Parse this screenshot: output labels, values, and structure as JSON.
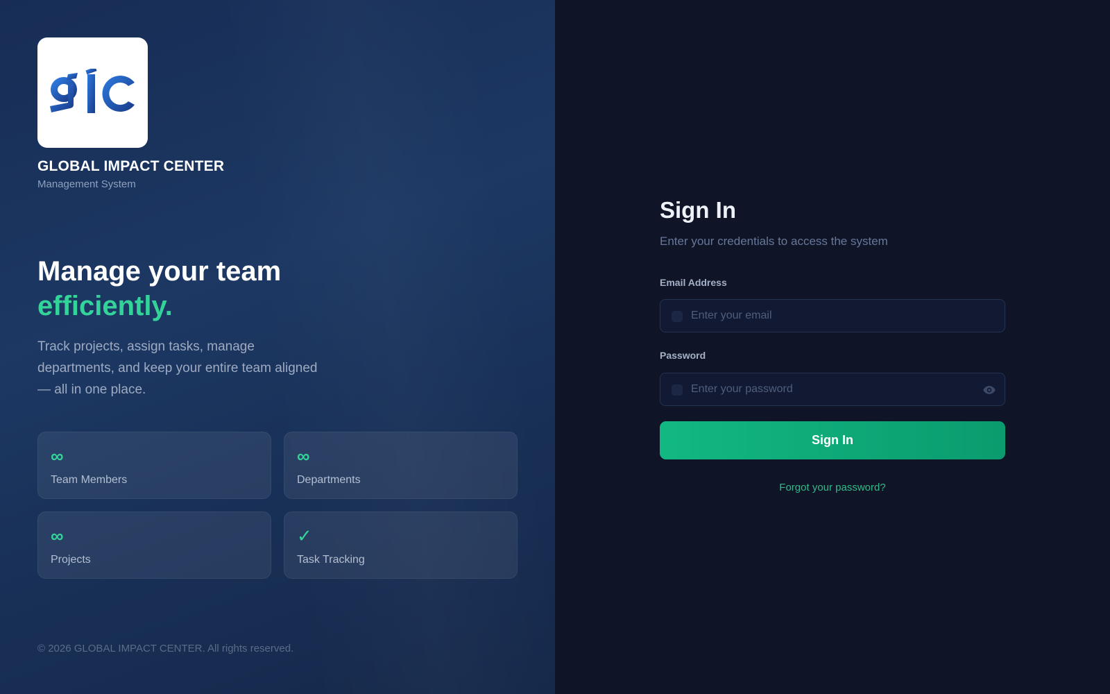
{
  "brand": {
    "logo_text": "gic",
    "name": "GLOBAL IMPACT CENTER",
    "subtitle": "Management System"
  },
  "hero": {
    "headline": "Manage your team",
    "headline_accent": "efficiently.",
    "description": "Track projects, assign tasks, manage departments, and keep your entire team aligned — all in one place."
  },
  "features": [
    {
      "value": "∞",
      "label": "Team Members",
      "icon": "infinity-icon"
    },
    {
      "value": "∞",
      "label": "Departments",
      "icon": "infinity-icon"
    },
    {
      "value": "∞",
      "label": "Projects",
      "icon": "infinity-icon"
    },
    {
      "value": "✓",
      "label": "Task Tracking",
      "icon": "check-icon"
    }
  ],
  "footer": {
    "copyright": "© 2026 GLOBAL IMPACT CENTER. All rights reserved."
  },
  "signin": {
    "title": "Sign In",
    "subtitle": "Enter your credentials to access the system",
    "email_label": "Email Address",
    "email_placeholder": "Enter your email",
    "email_value": "",
    "password_label": "Password",
    "password_placeholder": "Enter your password",
    "password_value": "",
    "button_label": "Sign In",
    "forgot_label": "Forgot your password?"
  },
  "colors": {
    "accent": "#34d399",
    "button": "#10b981",
    "left_panel": "#1c3863",
    "right_panel": "#0f1426"
  }
}
